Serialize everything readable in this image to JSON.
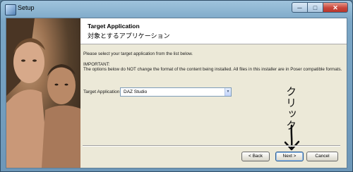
{
  "window": {
    "title": "Setup",
    "controls": {
      "minimize": "─",
      "maximize": "□",
      "close": "✕"
    }
  },
  "header": {
    "title": "Target Application",
    "subtitle": "対象とするアプリケーション"
  },
  "body": {
    "instruction": "Please select your target application from the list below.",
    "important_label": "IMPORTANT:",
    "important_text": "The options below do NOT change the format of the content being installed.  All files in this installer are in Poser compatible formats."
  },
  "target": {
    "label": "Target Application",
    "selected": "DAZ Studio",
    "arrow": "▼"
  },
  "buttons": {
    "back": "< Back",
    "next": "Next >",
    "cancel": "Cancel"
  },
  "annotation": {
    "text": "クリック",
    "arrow_icon": "down-arrow-icon"
  },
  "colors": {
    "dialog_background": "#ece9d8",
    "title_bar": "#7aa6c6",
    "close_button": "#c8453a"
  }
}
